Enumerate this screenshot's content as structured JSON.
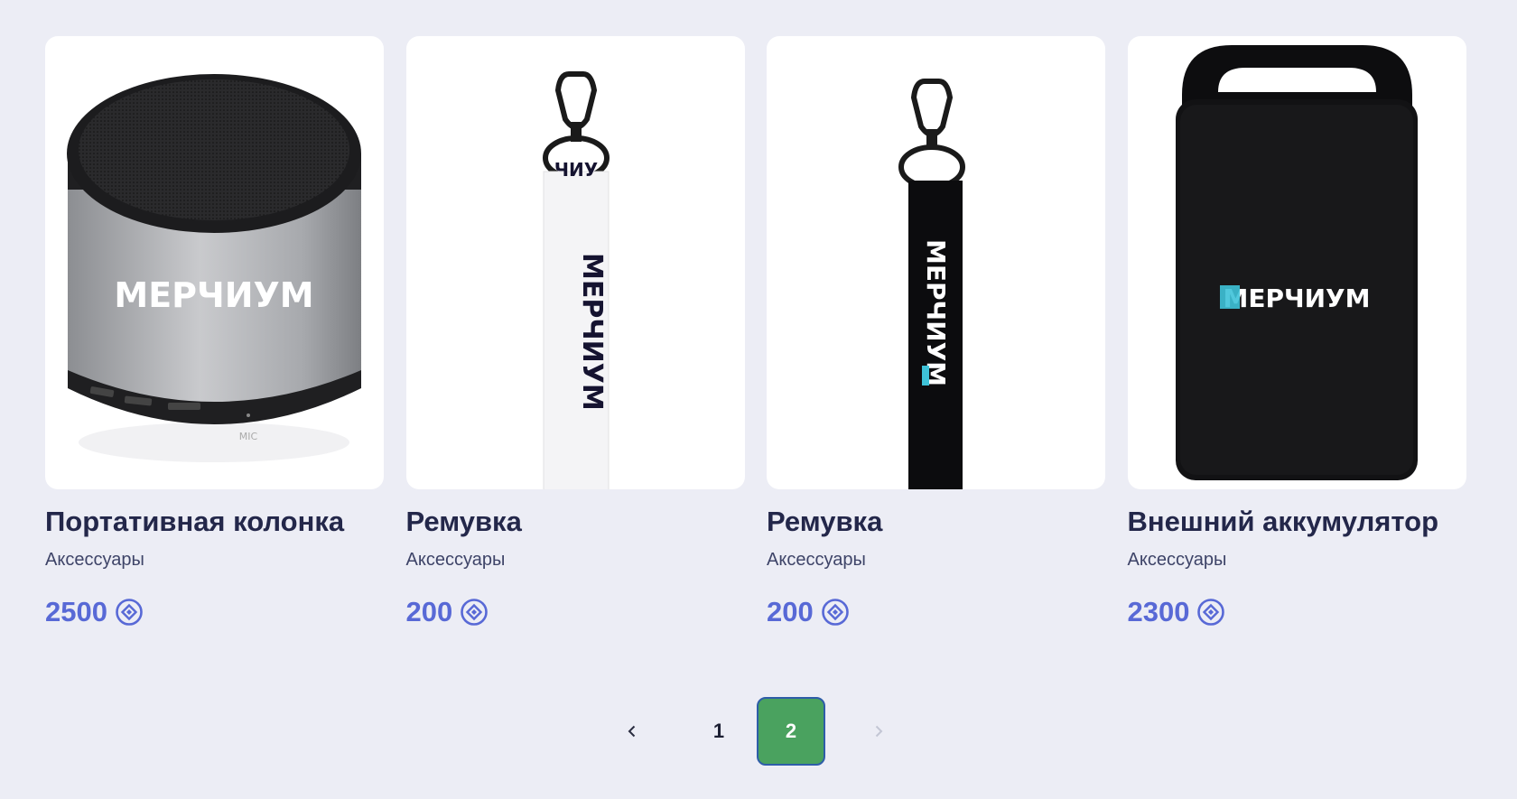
{
  "products": [
    {
      "title": "Портативная колонка",
      "category": "Аксессуары",
      "price": "2500",
      "image": "speaker",
      "logo": "МЕРЧИУМ"
    },
    {
      "title": "Ремувка",
      "category": "Аксессуары",
      "price": "200",
      "image": "lanyard-white",
      "logo": "МЕРЧИУМ"
    },
    {
      "title": "Ремувка",
      "category": "Аксессуары",
      "price": "200",
      "image": "lanyard-black",
      "logo": "МЕРЧИУМ"
    },
    {
      "title": "Внешний аккумулятор",
      "category": "Аксессуары",
      "price": "2300",
      "image": "powerbank",
      "logo": "МЕРЧИУМ"
    }
  ],
  "pagination": {
    "pages": [
      "1",
      "2"
    ],
    "current": "2",
    "prev_icon": "chevron-left-icon",
    "next_icon": "chevron-right-icon",
    "next_disabled": true
  },
  "currency_icon": "coin-icon",
  "colors": {
    "background": "#ECEDF5",
    "price": "#5869D6",
    "active_page": "#4AA25F",
    "title": "#23274A"
  }
}
